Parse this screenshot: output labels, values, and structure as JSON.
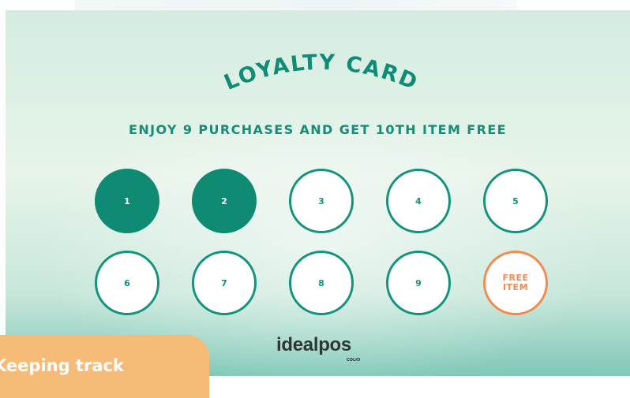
{
  "card": {
    "title": "LOYALTY CARD",
    "subtitle": "ENJOY 9 PURCHASES AND GET 10TH ITEM FREE",
    "stamps": [
      {
        "label": "1",
        "stamped": true
      },
      {
        "label": "2",
        "stamped": true
      },
      {
        "label": "3",
        "stamped": false
      },
      {
        "label": "4",
        "stamped": false
      },
      {
        "label": "5",
        "stamped": false
      },
      {
        "label": "6",
        "stamped": false
      },
      {
        "label": "7",
        "stamped": false
      },
      {
        "label": "8",
        "stamped": false
      },
      {
        "label": "9",
        "stamped": false
      }
    ],
    "free_stamp": {
      "line1": "FREE",
      "line2": "ITEM"
    },
    "brand": "idealpos",
    "brand_sub": "COLIO"
  },
  "tab": {
    "text": "Keeping track"
  },
  "colors": {
    "accent_green": "#0f8b74",
    "free_orange": "#f28a4f",
    "tab_orange": "#f7bb78",
    "brand_text": "#2f3638"
  }
}
